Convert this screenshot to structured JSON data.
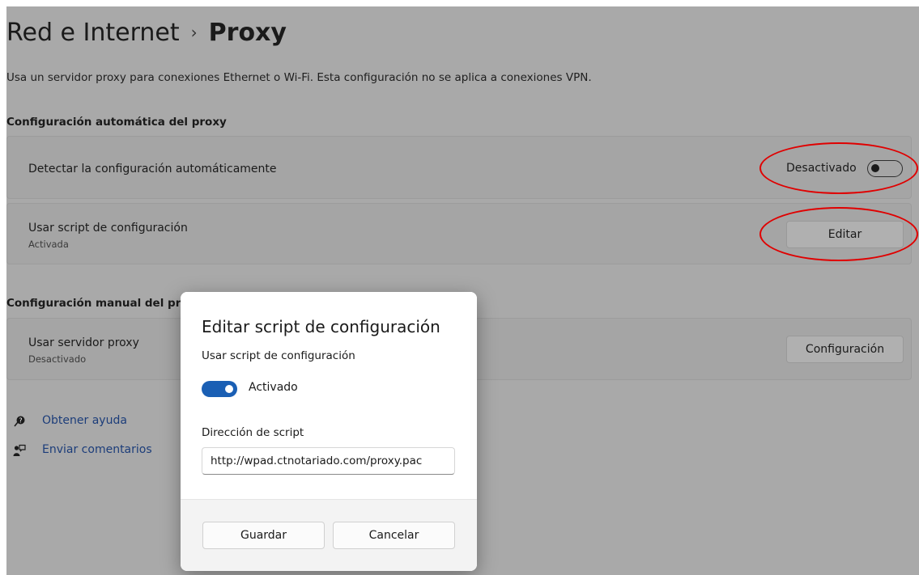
{
  "header": {
    "breadcrumb_parent": "Red e Internet",
    "separator": "›",
    "current": "Proxy"
  },
  "description": "Usa un servidor proxy para conexiones Ethernet o Wi-Fi. Esta configuración no se aplica a conexiones VPN.",
  "auto_section": {
    "heading": "Configuración automática del proxy",
    "detect": {
      "label": "Detectar la configuración automáticamente",
      "state_text": "Desactivado",
      "on": false
    },
    "script": {
      "label": "Usar script de configuración",
      "sub": "Activada",
      "button": "Editar"
    }
  },
  "manual_section": {
    "heading": "Configuración manual del pro",
    "server": {
      "label": "Usar servidor proxy",
      "sub": "Desactivado",
      "button": "Configuración"
    }
  },
  "links": [
    {
      "label": "Obtener ayuda",
      "icon": "help-icon"
    },
    {
      "label": "Enviar comentarios",
      "icon": "feedback-icon"
    }
  ],
  "dialog": {
    "title": "Editar script de configuración",
    "toggle_label": "Usar script de configuración",
    "toggle_state": "Activado",
    "toggle_on": true,
    "address_label": "Dirección de script",
    "address_value": "http://wpad.ctnotariado.com/proxy.pac",
    "save_button": "Guardar",
    "cancel_button": "Cancelar"
  },
  "colors": {
    "accent": "#1a5fb4",
    "annotation": "#e00000",
    "link": "#1c3d7a"
  }
}
